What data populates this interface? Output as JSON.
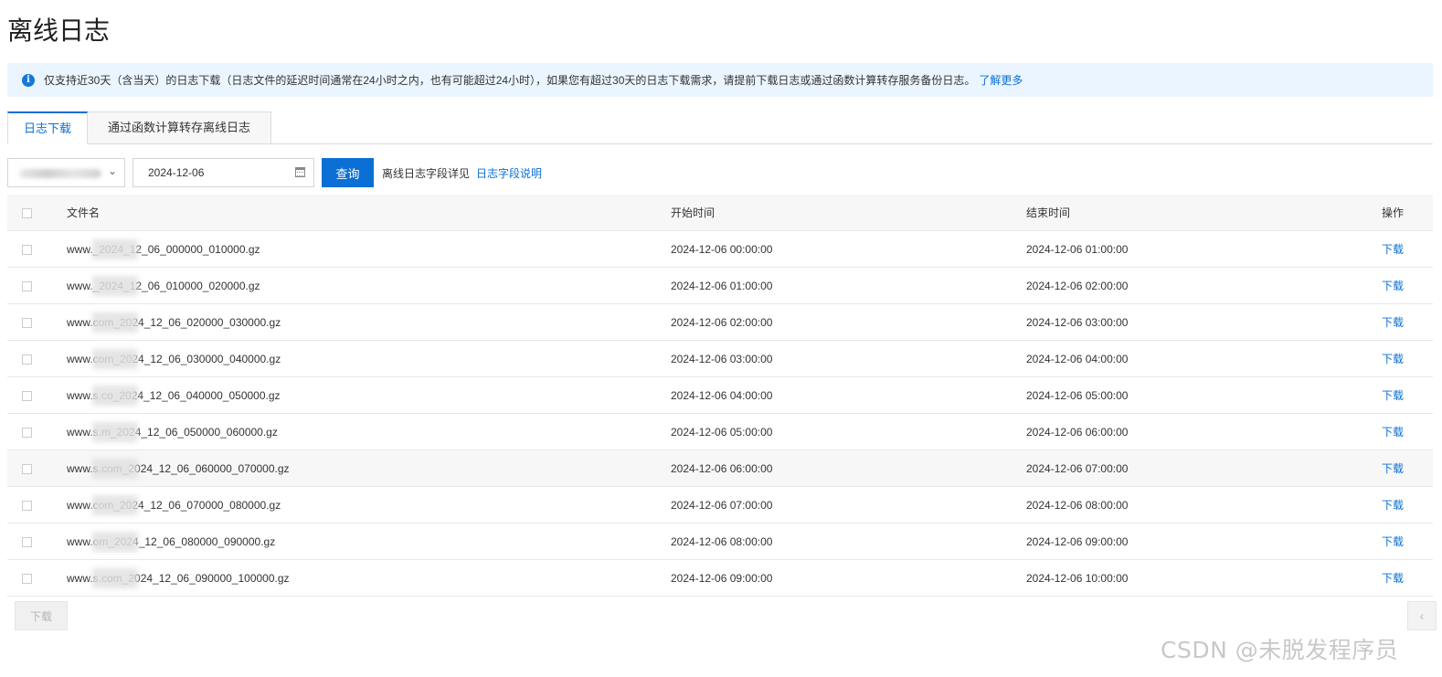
{
  "page": {
    "title": "离线日志"
  },
  "notice": {
    "text": "仅支持近30天（含当天）的日志下载（日志文件的延迟时间通常在24小时之内，也有可能超过24小时），如果您有超过30天的日志下载需求，请提前下载日志或通过函数计算转存服务备份日志。",
    "link_label": "了解更多"
  },
  "tabs": [
    {
      "label": "日志下载",
      "active": true
    },
    {
      "label": "通过函数计算转存离线日志",
      "active": false
    }
  ],
  "toolbar": {
    "date_value": "2024-12-06",
    "query_label": "查询",
    "field_detail_label": "离线日志字段详见",
    "field_detail_link": "日志字段说明"
  },
  "table": {
    "headers": {
      "name": "文件名",
      "start": "开始时间",
      "end": "结束时间",
      "action": "操作"
    },
    "rows": [
      {
        "name": "www._2024_12_06_000000_010000.gz",
        "start": "2024-12-06 00:00:00",
        "end": "2024-12-06 01:00:00",
        "action": "下载"
      },
      {
        "name": "www._2024_12_06_010000_020000.gz",
        "start": "2024-12-06 01:00:00",
        "end": "2024-12-06 02:00:00",
        "action": "下载"
      },
      {
        "name": "www.com_2024_12_06_020000_030000.gz",
        "start": "2024-12-06 02:00:00",
        "end": "2024-12-06 03:00:00",
        "action": "下载"
      },
      {
        "name": "www.com_2024_12_06_030000_040000.gz",
        "start": "2024-12-06 03:00:00",
        "end": "2024-12-06 04:00:00",
        "action": "下载"
      },
      {
        "name": "www.s.co_2024_12_06_040000_050000.gz",
        "start": "2024-12-06 04:00:00",
        "end": "2024-12-06 05:00:00",
        "action": "下载"
      },
      {
        "name": "www.s.m_2024_12_06_050000_060000.gz",
        "start": "2024-12-06 05:00:00",
        "end": "2024-12-06 06:00:00",
        "action": "下载"
      },
      {
        "name": "www.s.com_2024_12_06_060000_070000.gz",
        "start": "2024-12-06 06:00:00",
        "end": "2024-12-06 07:00:00",
        "action": "下载"
      },
      {
        "name": "www.com_2024_12_06_070000_080000.gz",
        "start": "2024-12-06 07:00:00",
        "end": "2024-12-06 08:00:00",
        "action": "下载"
      },
      {
        "name": "www.om_2024_12_06_080000_090000.gz",
        "start": "2024-12-06 08:00:00",
        "end": "2024-12-06 09:00:00",
        "action": "下载"
      },
      {
        "name": "www.s.com_2024_12_06_090000_100000.gz",
        "start": "2024-12-06 09:00:00",
        "end": "2024-12-06 10:00:00",
        "action": "下载"
      }
    ]
  },
  "footer": {
    "download_label": "下载",
    "pager_prev": "‹"
  },
  "watermark": "CSDN @未脱发程序员",
  "colors": {
    "accent": "#0b6fd6",
    "notice_bg": "#ebf5ff",
    "header_bg": "#f7f7f7"
  }
}
